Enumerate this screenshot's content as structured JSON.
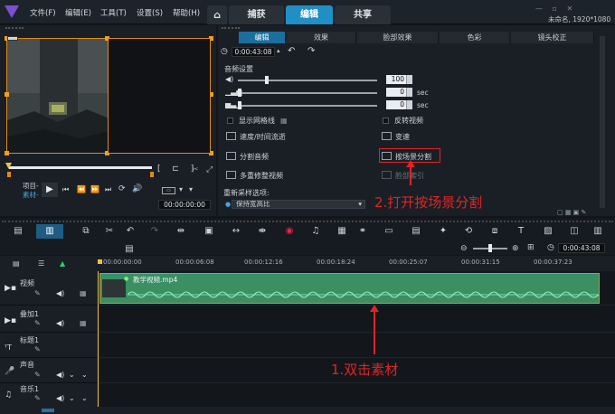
{
  "menu": {
    "items": [
      "文件(F)",
      "编辑(E)",
      "工具(T)",
      "设置(S)",
      "帮助(H)"
    ],
    "home_icon": "home-icon"
  },
  "main_tabs": [
    "捕获",
    "编辑",
    "共享"
  ],
  "project_info": "未命名, 1920*1080",
  "preview": {
    "project_label": "项目-",
    "clip_label": "素材-",
    "timecode": "00:00:00:00"
  },
  "options_panel": {
    "tabs": [
      "编辑",
      "效果",
      "脸部效果",
      "色彩",
      "镜头校正"
    ],
    "duration": "0:00:43:08",
    "audio_settings_label": "音频设置",
    "volume_value": "100",
    "fade_in_value": "0",
    "fade_out_value": "0",
    "sec_label": "sec",
    "show_grid": "显示网格线",
    "reverse_video": "反转视频",
    "speed_time": "速度/时间流逝",
    "variable_speed": "变速",
    "split_audio": "分割音频",
    "split_by_scene": "按场景分割",
    "multi_trim": "多重修整视频",
    "face_index": "脸部索引",
    "resample_label": "重新采样选项:",
    "resample_value": "保持宽高比"
  },
  "timeline": {
    "zoom_timecode": "0:00:43:08",
    "ruler_ticks": [
      "00:00:00:00",
      "00:00:06:08",
      "00:00:12:16",
      "00:00:18:24",
      "00:00:25:07",
      "00:00:31:15",
      "00:00:37:23"
    ],
    "tracks": [
      "视频",
      "叠加1",
      "标题1",
      "声音",
      "音乐1"
    ],
    "clip_name": "教学视频.mp4"
  },
  "annotations": {
    "step1": "1.双击素材",
    "step2": "2.打开按场景分割"
  },
  "colors": {
    "accent": "#1f8fc6",
    "clip": "#3a8f63",
    "highlight": "#e02424"
  }
}
